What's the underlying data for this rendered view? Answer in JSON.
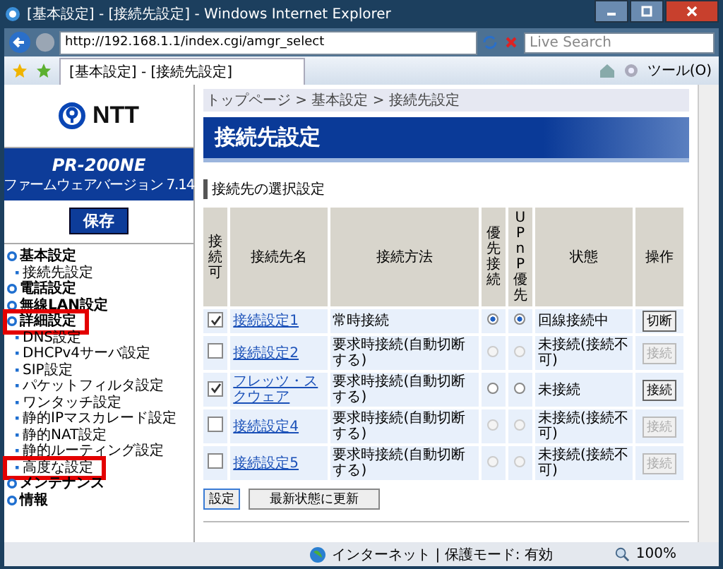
{
  "window": {
    "title": "[基本設定] - [接続先設定] - Windows Internet Explorer"
  },
  "address_bar": {
    "url": "http://192.168.1.1/index.cgi/amgr_select",
    "search_placeholder": "Live Search"
  },
  "tab": {
    "title": "[基本設定] - [接続先設定]"
  },
  "tools_menu": "ツール(O)",
  "sidebar": {
    "logo": "NTT",
    "model": "PR-200NE",
    "firmware": "ファームウェアバージョン 7.14",
    "save_button": "保存",
    "items": [
      {
        "label": "基本設定",
        "kind": "section",
        "highlighted": false
      },
      {
        "label": "接続先設定",
        "kind": "link",
        "highlighted": false
      },
      {
        "label": "電話設定",
        "kind": "section",
        "highlighted": false
      },
      {
        "label": "無線LAN設定",
        "kind": "section",
        "highlighted": false
      },
      {
        "label": "詳細設定",
        "kind": "section",
        "highlighted": true
      },
      {
        "label": "DNS設定",
        "kind": "link",
        "highlighted": false
      },
      {
        "label": "DHCPv4サーバ設定",
        "kind": "link",
        "highlighted": false
      },
      {
        "label": "SIP設定",
        "kind": "link",
        "highlighted": false
      },
      {
        "label": "パケットフィルタ設定",
        "kind": "link",
        "highlighted": false
      },
      {
        "label": "ワンタッチ設定",
        "kind": "link",
        "highlighted": false
      },
      {
        "label": "静的IPマスカレード設定",
        "kind": "link",
        "highlighted": false
      },
      {
        "label": "静的NAT設定",
        "kind": "link",
        "highlighted": false
      },
      {
        "label": "静的ルーティング設定",
        "kind": "link",
        "highlighted": false
      },
      {
        "label": "高度な設定",
        "kind": "link",
        "highlighted": true
      },
      {
        "label": "メンテナンス",
        "kind": "section",
        "highlighted": false
      },
      {
        "label": "情報",
        "kind": "section",
        "highlighted": false
      }
    ]
  },
  "breadcrumb": "トップページ > 基本設定 > 接続先設定",
  "page_title": "接続先設定",
  "section_title": "接続先の選択設定",
  "table": {
    "columns": [
      "接続可",
      "接続先名",
      "接続方法",
      "優先接続",
      "UPnP優先",
      "状態",
      "操作"
    ],
    "rows": [
      {
        "enabled": true,
        "name": "接続設定1",
        "method": "常時接続",
        "priority_selected": true,
        "upnp_selected": true,
        "disabled": false,
        "status": "回線接続中",
        "action": "切断",
        "action_disabled": false
      },
      {
        "enabled": false,
        "name": "接続設定2",
        "method": "要求時接続(自動切断する)",
        "priority_selected": false,
        "upnp_selected": false,
        "disabled": true,
        "status": "未接続(接続不可)",
        "action": "接続",
        "action_disabled": true
      },
      {
        "enabled": true,
        "name": "フレッツ・スクウェア",
        "method": "要求時接続(自動切断する)",
        "priority_selected": false,
        "upnp_selected": false,
        "disabled": false,
        "status": "未接続",
        "action": "接続",
        "action_disabled": false
      },
      {
        "enabled": false,
        "name": "接続設定4",
        "method": "要求時接続(自動切断する)",
        "priority_selected": false,
        "upnp_selected": false,
        "disabled": true,
        "status": "未接続(接続不可)",
        "action": "接続",
        "action_disabled": true
      },
      {
        "enabled": false,
        "name": "接続設定5",
        "method": "要求時接続(自動切断する)",
        "priority_selected": false,
        "upnp_selected": false,
        "disabled": true,
        "status": "未接続(接続不可)",
        "action": "接続",
        "action_disabled": true
      }
    ]
  },
  "buttons": [
    "設定",
    "最新状態に更新"
  ],
  "status_bar": {
    "zone": "インターネット | 保護モード: 有効",
    "zoom": "100%"
  }
}
